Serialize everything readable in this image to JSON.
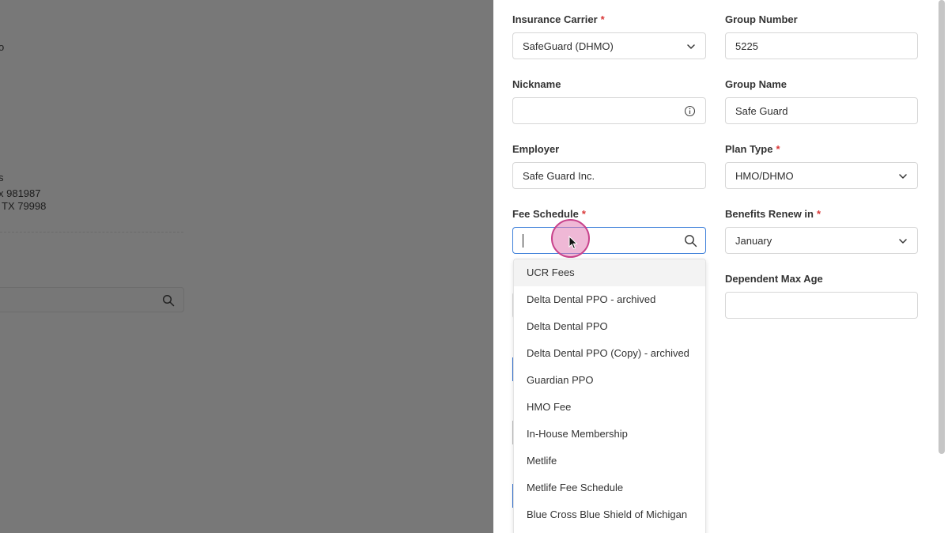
{
  "background": {
    "fragments": [
      "o",
      "s",
      "x 981987",
      "TX 79998"
    ]
  },
  "form": {
    "insurance_carrier": {
      "label": "Insurance Carrier",
      "required": "*",
      "value": "SafeGuard (DHMO)"
    },
    "group_number": {
      "label": "Group Number",
      "value": "5225"
    },
    "nickname": {
      "label": "Nickname",
      "value": ""
    },
    "group_name": {
      "label": "Group Name",
      "value": "Safe Guard"
    },
    "employer": {
      "label": "Employer",
      "value": "Safe Guard Inc."
    },
    "plan_type": {
      "label": "Plan Type",
      "required": "*",
      "value": "HMO/DHMO"
    },
    "fee_schedule": {
      "label": "Fee Schedule",
      "required": "*",
      "value": ""
    },
    "benefits_renew": {
      "label": "Benefits Renew in",
      "required": "*",
      "value": "January"
    },
    "dependent_max_age": {
      "label": "Dependent Max Age",
      "value": ""
    }
  },
  "fee_schedule_options": [
    "UCR Fees",
    "Delta Dental PPO - archived",
    "Delta Dental PPO",
    "Delta Dental PPO (Copy) - archived",
    "Guardian PPO",
    "HMO Fee",
    "In-House Membership",
    "Metlife",
    "Metlife Fee Schedule",
    "Blue Cross Blue Shield of Michigan"
  ],
  "colors": {
    "required": "#d93838",
    "focus_border": "#3d7fd9",
    "click_indicator": "#c8428b"
  }
}
